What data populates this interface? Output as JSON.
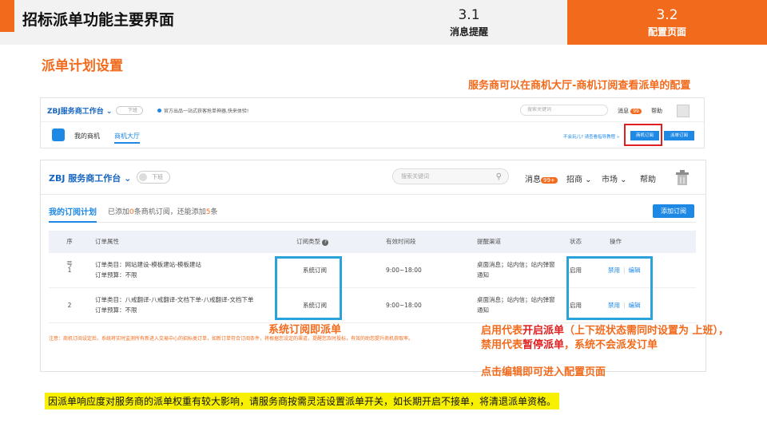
{
  "slide": {
    "title": "招标派单功能主要界面",
    "tabs": [
      {
        "num": "3.1",
        "label": "消息提醒"
      },
      {
        "num": "3.2",
        "label": "配置页面"
      }
    ],
    "section_title": "派单计划设置",
    "top_note": "服务商可以在商机大厅-商机订阅查看派单的配置",
    "bottom_note": "因派单响应度对服务商的派单权重有较大影响，请服务商按需灵活设置派单开关，如长期开启不接单，将清退派单资格。"
  },
  "mini": {
    "brand": "ZBJ服务商工作台 ⌄",
    "toggle": "下班",
    "notice": "官方出品一站式获客抢单神器,快来体验!",
    "search_placeholder": "搜索关键词",
    "msg_label": "消息",
    "msg_badge": "99",
    "help": "帮助",
    "tab_my": "我的商机",
    "tab_hall": "商机大厅",
    "hint": "不会玩儿? 请查看指导教程 »",
    "btn_subscribe": "商机订阅",
    "btn_dispatch": "派单订阅"
  },
  "header": {
    "brand": "ZBJ 服务商工作台 ⌄",
    "toggle": "下班",
    "search_placeholder": "搜索关键词",
    "msg_label": "消息",
    "msg_badge": "99+",
    "bid": "招商 ⌄",
    "market": "市场 ⌄",
    "help": "帮助"
  },
  "plan": {
    "tab_label": "我的订阅计划",
    "info_prefix": "已添加",
    "added": "0",
    "info_mid": "条商机订阅，还能添加",
    "remain": "5",
    "info_suffix": "条",
    "add_button": "添加订阅"
  },
  "table": {
    "headers": {
      "no": "序号",
      "attr": "订单属性",
      "type": "订阅类型",
      "time": "有效时间段",
      "channel": "提醒渠道",
      "status": "状态",
      "op": "操作"
    },
    "rows": [
      {
        "no": "1",
        "category": "订单类目：网站建设-模板建站-模板建站",
        "budget": "订单预算：不限",
        "type": "系统订阅",
        "time": "9:00~18:00",
        "channel1": "桌面消息；站内信；站内弹窗",
        "channel2": "通知",
        "status": "启用",
        "op_disable": "禁用",
        "op_edit": "编辑"
      },
      {
        "no": "2",
        "category": "订单类目：八戒翻译-八戒翻译-文档下单-八戒翻译-文档下单",
        "budget": "订单预算：不限",
        "type": "系统订阅",
        "time": "9:00~18:00",
        "channel1": "桌面消息；站内信；站内弹窗",
        "channel2": "通知",
        "status": "启用",
        "op_disable": "禁用",
        "op_edit": "编辑"
      }
    ],
    "footnote": "注意：商机订阅设定后，系统将实时监测所有新进入交易中心的招标类订单，如新订单符合订阅条件，将根据您设定的渠道，提醒您及时投标，有效的助您提升商机获取率。"
  },
  "annotations": {
    "left": "系统订阅即派单",
    "r1_a": "启用代表",
    "r1_b": "开启派单",
    "r1_c": "（上下班状态需同时设置为 上班），",
    "r2_a": "禁用代表",
    "r2_b": "暂停派单",
    "r2_c": "，系统不会派发订单",
    "r3": "点击编辑即可进入配置页面"
  },
  "colors": {
    "accent": "#f26b1d",
    "link": "#1e88e5",
    "highlight_box": "#29a3d9",
    "red": "#e02020",
    "note_bg": "#f7f000"
  }
}
